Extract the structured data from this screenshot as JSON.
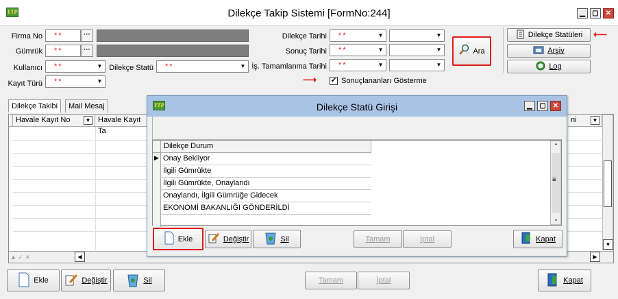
{
  "window": {
    "title": "Dilekçe Takip Sistemi [FormNo:244]",
    "logo": "YTP"
  },
  "filters": {
    "firma_no": {
      "label": "Firma No",
      "value": "**"
    },
    "gumruk": {
      "label": "Gümrük",
      "value": "**"
    },
    "kullanici": {
      "label": "Kullanıcı",
      "value": "**"
    },
    "kayit_turu": {
      "label": "Kayıt Türü",
      "value": "**"
    },
    "dilekce_statu": {
      "label": "Dilekçe Statü",
      "value": "**"
    },
    "dilekce_tarihi": {
      "label": "Dilekçe Tarihi",
      "value": "**"
    },
    "sonuc_tarihi": {
      "label": "Sonuç Tarihi",
      "value": "**"
    },
    "is_tamamlanma_tarihi": {
      "label": "İş. Tamamlanma Tarihi",
      "value": "**"
    },
    "sonuclananlari_gosterme": {
      "label": "Sonuçlananları Gösterme",
      "checked": true,
      "mark": "✔"
    }
  },
  "buttons": {
    "ara": "Ara",
    "dilekce_statuleri": "Dilekçe Statüleri",
    "arsiv": "Arşiv",
    "log": "Log"
  },
  "tabs": [
    "Dilekçe Takibi",
    "Mail Mesaj"
  ],
  "main_grid": {
    "columns": [
      "Havale Kayıt No",
      "Havale Kayıt Ta",
      "ni"
    ]
  },
  "bottom_toolbar": {
    "ekle": "Ekle",
    "degistir": "Değiştir",
    "sil": "Sil",
    "tamam": "Tamam",
    "iptal": "İptal",
    "kapat": "Kapat",
    "nav_marks": "▲ ✓ ✕"
  },
  "dialog": {
    "title": "Dilekçe Statü Girişi",
    "logo": "YTP",
    "column": "Dilekçe Durum",
    "current_marker": "▶",
    "rows": [
      "Onay Bekliyor",
      "İlgili Gümrükte",
      "İlgili Gümrükte, Onaylandı",
      "Onaylandı, İlgili Gümrüğe Gidecek",
      "EKONOMİ BAKANLIĞI GÖNDERİLDİ"
    ],
    "toolbar": {
      "ekle": "Ekle",
      "degistir": "Değiştir",
      "sil": "Sil",
      "tamam": "Tamam",
      "iptal": "İptal",
      "kapat": "Kapat"
    }
  },
  "colors": {
    "accent_red": "#e01a1a",
    "dialog_title_bg": "#a9c3e5",
    "readonly_gray": "#7e7e7e"
  }
}
